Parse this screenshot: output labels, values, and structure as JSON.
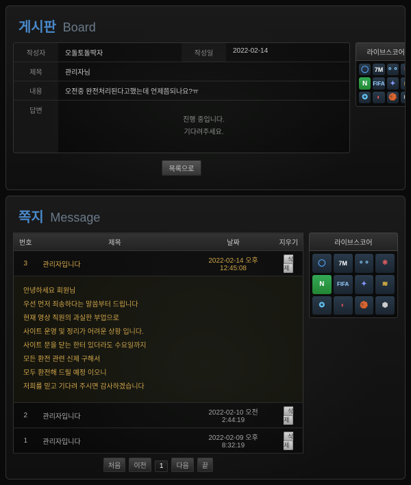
{
  "board": {
    "title_kr": "게시판",
    "title_en": "Board",
    "fields": {
      "author_label": "작성자",
      "author_value": "오돌토돌딱자",
      "regdate_label": "작성일",
      "regdate_value": "2022-02-14",
      "subject_label": "제목",
      "subject_value": "관리자님",
      "content_label": "내용",
      "content_value": "오전중 완전처리된다고했는데 언제쯤되나요?ㅠ",
      "reply_label": "답변",
      "reply_line1": "진행 중입니다.",
      "reply_line2": "기다려주세요."
    },
    "list_button": "목록으로"
  },
  "message": {
    "title_kr": "쪽지",
    "title_en": "Message",
    "headers": {
      "no": "번호",
      "subject": "제목",
      "date": "날짜",
      "delete": "지우기"
    },
    "delete_label": "삭제",
    "rows": [
      {
        "no": "3",
        "subject": "관리자입니다",
        "date": "2022-02-14 오후 12:45:08"
      },
      {
        "no": "2",
        "subject": "관리자입니다",
        "date": "2022-02-10 오전 2:44:19"
      },
      {
        "no": "1",
        "subject": "관리자입니다",
        "date": "2022-02-09 오후 8:32:19"
      }
    ],
    "expanded_body": [
      "안녕하세요 회원님",
      "우선 먼저 죄송하다는 말씀부터 드립니다",
      "현재 영상 직원의 과실한 부업으로",
      "사이트 운영 및 정리가 어려운 상황 입니다.",
      "사이트 문을 닫는 한터 있더라도 수요일까지",
      "모든 환전 관련 신제 구해서",
      "모두 환전해 드릴 예정 이오니",
      "저희를 믿고 기다려 주시면 감사하겠습니다"
    ],
    "pager": {
      "first": "처음",
      "prev": "이전",
      "page": "1",
      "next": "다음",
      "last": "끝"
    }
  },
  "sidebar": {
    "title": "라이브스코어",
    "icons": [
      "◯",
      "7M",
      "⚬⚬",
      "⚛",
      "N",
      "FIFA",
      "✦",
      "≋",
      "✪",
      "◐",
      "🏀",
      "⬢"
    ]
  }
}
